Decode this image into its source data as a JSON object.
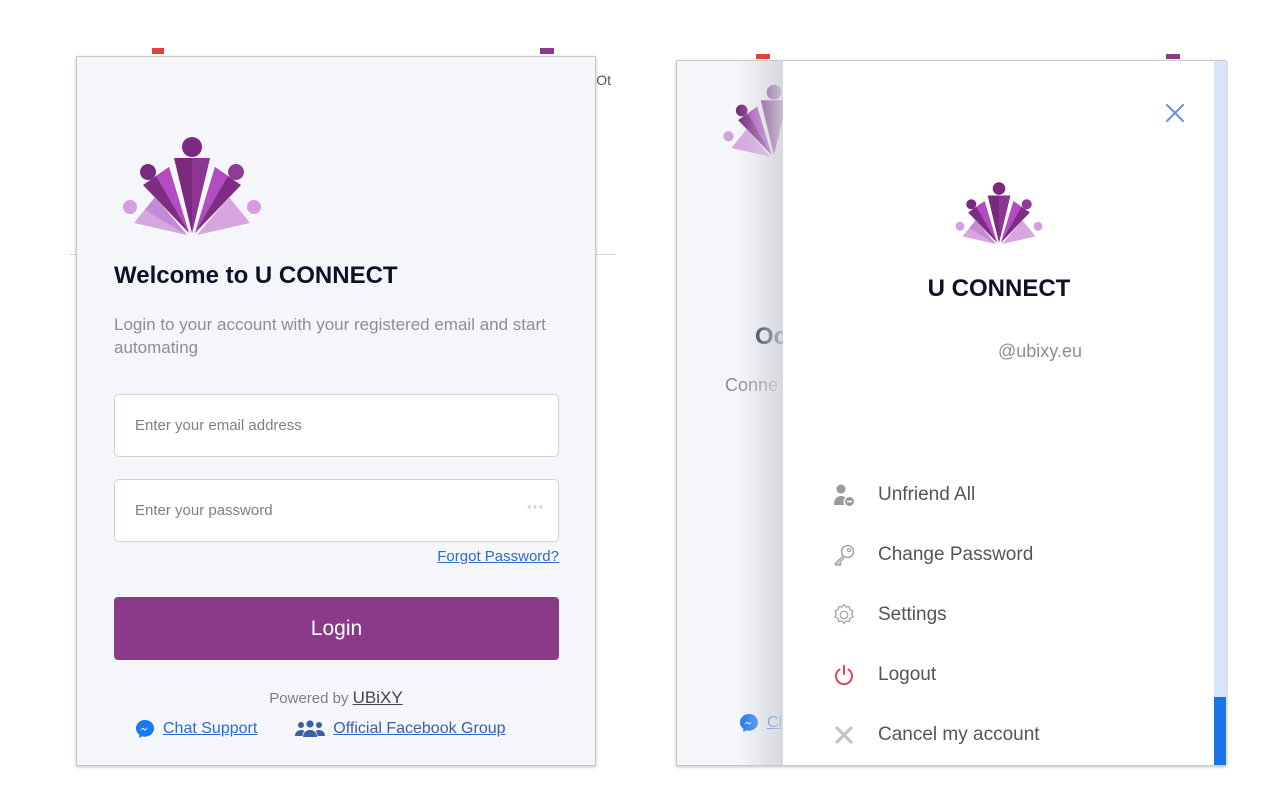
{
  "login_panel": {
    "background_tab_text": "Ot",
    "logo": "u-connect-logo",
    "title": "Welcome to U CONNECT",
    "subtitle": "Login to your account with your registered email and start automating",
    "email_placeholder": "Enter your email address",
    "email_value": "",
    "password_placeholder": "Enter your password",
    "password_value": "",
    "password_mask_hint": "***",
    "forgot_password": "Forgot Password?",
    "login_button": "Login",
    "powered_by": "Powered by",
    "powered_brand": "UBiXY",
    "chat_support": "Chat Support",
    "facebook_group": "Official Facebook Group",
    "accent_color": "#8a3a88"
  },
  "account_panel": {
    "background": {
      "title_fragment": "Oc",
      "subtitle_fragment": "Conne",
      "chat_fragment": "Cl"
    },
    "drawer": {
      "title": "U CONNECT",
      "email": "@ubixy.eu",
      "menu": [
        {
          "label": "Unfriend All",
          "icon": "user-remove-icon"
        },
        {
          "label": "Change Password",
          "icon": "key-icon"
        },
        {
          "label": "Settings",
          "icon": "gear-icon"
        },
        {
          "label": "Logout",
          "icon": "power-icon"
        },
        {
          "label": "Cancel my account",
          "icon": "cancel-icon"
        }
      ]
    }
  }
}
